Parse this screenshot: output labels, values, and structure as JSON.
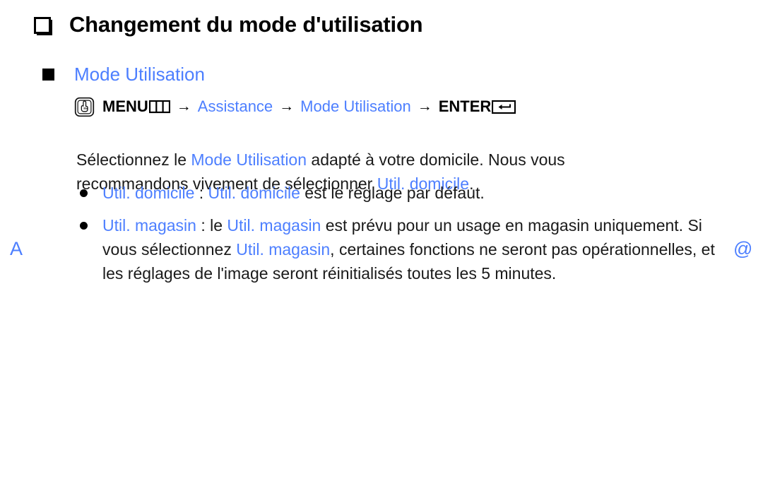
{
  "page": {
    "title": "Changement du mode d'utilisation",
    "title_bullet_icon": "shadowed-hollow-square-bullet",
    "colors": {
      "accent_blue": "#4d7fff",
      "text_black": "#1a1a1a",
      "background": "#ffffff"
    }
  },
  "section": {
    "heading": "Mode Utilisation",
    "heading_bullet_icon": "filled-square-bullet"
  },
  "menu_path": {
    "oo_icon": "hand-press-button-icon",
    "segments": [
      {
        "text": "MENU",
        "style": "bold-black",
        "glyph": "menu-grid-icon"
      },
      {
        "text": "Assistance",
        "style": "blue"
      },
      {
        "text": "Mode Utilisation",
        "style": "blue"
      },
      {
        "text": "ENTER",
        "style": "bold-black",
        "glyph": "enter-return-icon"
      }
    ],
    "arrow": "→"
  },
  "paragraph": {
    "part1": "Sélectionnez le ",
    "highlight1": "Mode Utilisation",
    "part2": " adapté à votre domicile. Nous vous recommandons vivement de sélectionner ",
    "highlight2": "Util. domicile",
    "part3": "."
  },
  "bullets": [
    {
      "dot_icon": "bullet-dot-icon",
      "term": "Util. domicile",
      "separator": " : ",
      "highlight_mid": "Util. domicile",
      "rest": " est le réglage par défaut."
    },
    {
      "dot_icon": "bullet-dot-icon",
      "term": "Util. magasin",
      "separator": " : le ",
      "highlight_mid": "Util. magasin",
      "rest": " est prévu pour un usage en magasin uniquement. Si vous sélectionnez ",
      "highlight_end": "Util. magasin",
      "tail": ", certaines fonctions ne seront pas opérationnelles, et les réglages de l'image seront réinitialisés toutes les 5 minutes."
    }
  ],
  "margin_marks": {
    "left": "A",
    "right": "@"
  }
}
